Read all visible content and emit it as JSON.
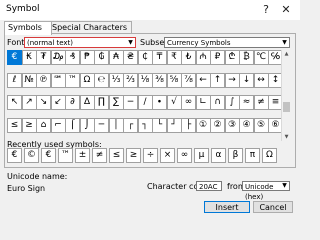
{
  "window": {
    "title": "Symbol",
    "help_glyph": "?",
    "close_glyph": "✕"
  },
  "tabs": [
    {
      "label": "Symbols",
      "active": true
    },
    {
      "label": "Special Characters",
      "active": false
    }
  ],
  "font": {
    "label": "Font:",
    "value": "(normal text)"
  },
  "subset": {
    "label": "Subset:",
    "value": "Currency Symbols"
  },
  "grid_rows": [
    [
      "€",
      "₭",
      "₮",
      "₯",
      "₰",
      "₱",
      "₲",
      "₳",
      "₴",
      "₵",
      "₸",
      "₹",
      "₺",
      "₼",
      "₽",
      "₾",
      "₿",
      "℃",
      "℅"
    ],
    [
      "ℓ",
      "№",
      "℗",
      "℠",
      "™",
      "Ω",
      "℮",
      "⅓",
      "⅔",
      "⅛",
      "⅜",
      "⅝",
      "⅞",
      "←",
      "↑",
      "→",
      "↓",
      "↔",
      "↕"
    ],
    [
      "↖",
      "↗",
      "↘",
      "↙",
      "∂",
      "∆",
      "∏",
      "∑",
      "−",
      "∕",
      "∙",
      "√",
      "∞",
      "∟",
      "∩",
      "∫",
      "≈",
      "≠",
      "≡"
    ],
    [
      "≤",
      "≥",
      "⌂",
      "⌐",
      "⌠",
      "⌡",
      "─",
      "│",
      "┌",
      "┐",
      "└",
      "┘",
      "├",
      "①",
      "②",
      "③",
      "④",
      "⑤",
      "⑥"
    ]
  ],
  "recent": {
    "label": "Recently used symbols:",
    "symbols": [
      "€",
      "©",
      "€",
      "™",
      "±",
      "≠",
      "≤",
      "≥",
      "÷",
      "×",
      "∞",
      "µ",
      "α",
      "β",
      "π",
      "Ω"
    ]
  },
  "unicode_name": {
    "label": "Unicode name:",
    "value": "Euro Sign"
  },
  "character_code": {
    "label": "Character code:",
    "value": "20AC"
  },
  "from": {
    "label": "from:",
    "value": "Unicode (hex)"
  },
  "buttons": {
    "insert": "Insert",
    "cancel": "Cancel"
  }
}
